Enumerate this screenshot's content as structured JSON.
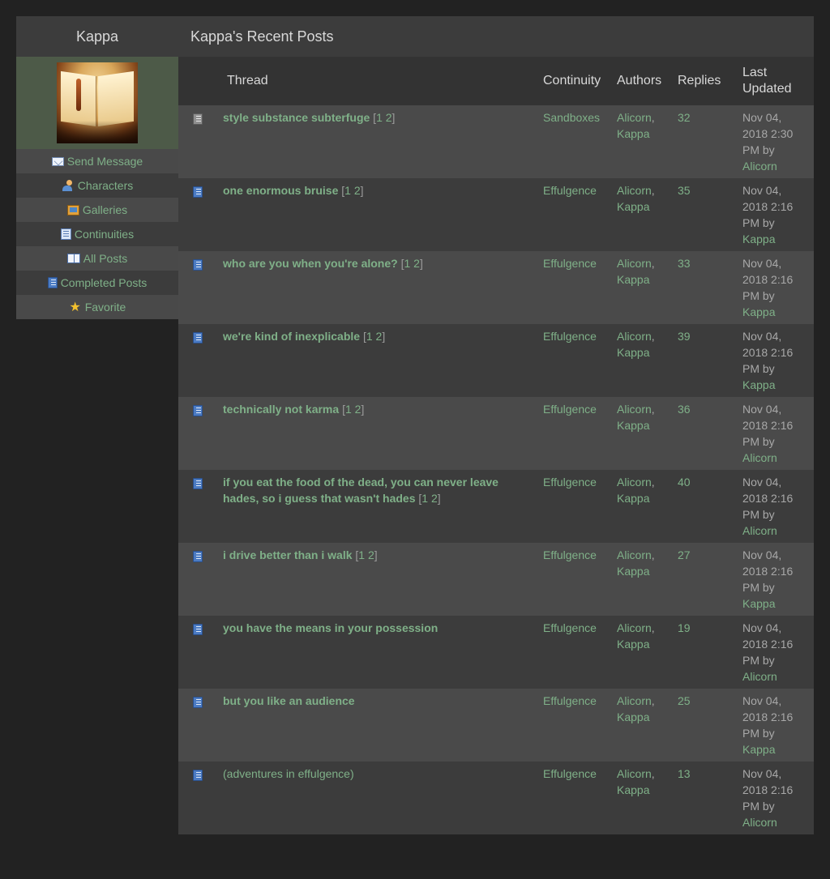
{
  "sidebar": {
    "name": "Kappa",
    "items": [
      {
        "label": "Send Message",
        "icon": "mail-icon"
      },
      {
        "label": "Characters",
        "icon": "characters-icon"
      },
      {
        "label": "Galleries",
        "icon": "gallery-icon"
      },
      {
        "label": "Continuities",
        "icon": "continuities-icon"
      },
      {
        "label": "All Posts",
        "icon": "open-book-icon"
      },
      {
        "label": "Completed Posts",
        "icon": "book-icon"
      },
      {
        "label": "Favorite",
        "icon": "star-icon"
      }
    ]
  },
  "main": {
    "title": "Kappa's Recent Posts",
    "columns": {
      "thread": "Thread",
      "continuity": "Continuity",
      "authors": "Authors",
      "replies": "Replies",
      "last_updated": "Last Updated"
    },
    "rows": [
      {
        "title": "style substance subterfuge",
        "pages": [
          "1",
          "2"
        ],
        "continuity": "Sandboxes",
        "author1": "Alicorn",
        "author2": "Kappa",
        "replies": "32",
        "updated": "Nov 04, 2018 2:30 PM by",
        "updated_by": "Alicorn",
        "icon": "grey-book-icon"
      },
      {
        "title": "one enormous bruise",
        "pages": [
          "1",
          "2"
        ],
        "continuity": "Effulgence",
        "author1": "Alicorn",
        "author2": "Kappa",
        "replies": "35",
        "updated": "Nov 04, 2018 2:16 PM by",
        "updated_by": "Kappa",
        "icon": "book-icon"
      },
      {
        "title": "who are you when you're alone?",
        "pages": [
          "1",
          "2"
        ],
        "continuity": "Effulgence",
        "author1": "Alicorn",
        "author2": "Kappa",
        "replies": "33",
        "updated": "Nov 04, 2018 2:16 PM by",
        "updated_by": "Kappa",
        "icon": "book-icon"
      },
      {
        "title": "we're kind of inexplicable",
        "pages": [
          "1",
          "2"
        ],
        "continuity": "Effulgence",
        "author1": "Alicorn",
        "author2": "Kappa",
        "replies": "39",
        "updated": "Nov 04, 2018 2:16 PM by",
        "updated_by": "Kappa",
        "icon": "book-icon"
      },
      {
        "title": "technically not karma",
        "pages": [
          "1",
          "2"
        ],
        "continuity": "Effulgence",
        "author1": "Alicorn",
        "author2": "Kappa",
        "replies": "36",
        "updated": "Nov 04, 2018 2:16 PM by",
        "updated_by": "Alicorn",
        "icon": "book-icon"
      },
      {
        "title": "if you eat the food of the dead, you can never leave hades, so i guess that wasn't hades",
        "pages": [
          "1",
          "2"
        ],
        "continuity": "Effulgence",
        "author1": "Alicorn",
        "author2": "Kappa",
        "replies": "40",
        "updated": "Nov 04, 2018 2:16 PM by",
        "updated_by": "Alicorn",
        "icon": "book-icon"
      },
      {
        "title": "i drive better than i walk",
        "pages": [
          "1",
          "2"
        ],
        "continuity": "Effulgence",
        "author1": "Alicorn",
        "author2": "Kappa",
        "replies": "27",
        "updated": "Nov 04, 2018 2:16 PM by",
        "updated_by": "Kappa",
        "icon": "book-icon"
      },
      {
        "title": "you have the means in your possession",
        "pages": [],
        "continuity": "Effulgence",
        "author1": "Alicorn",
        "author2": "Kappa",
        "replies": "19",
        "updated": "Nov 04, 2018 2:16 PM by",
        "updated_by": "Alicorn",
        "icon": "book-icon"
      },
      {
        "title": "but you like an audience",
        "pages": [],
        "continuity": "Effulgence",
        "author1": "Alicorn",
        "author2": "Kappa",
        "replies": "25",
        "updated": "Nov 04, 2018 2:16 PM by",
        "updated_by": "Kappa",
        "icon": "book-icon"
      },
      {
        "title": "(adventures in effulgence)",
        "pages": [],
        "continuity": "Effulgence",
        "author1": "Alicorn",
        "author2": "Kappa",
        "replies": "13",
        "updated": "Nov 04, 2018 2:16 PM by",
        "updated_by": "Alicorn",
        "icon": "book-icon",
        "read": true
      }
    ]
  }
}
